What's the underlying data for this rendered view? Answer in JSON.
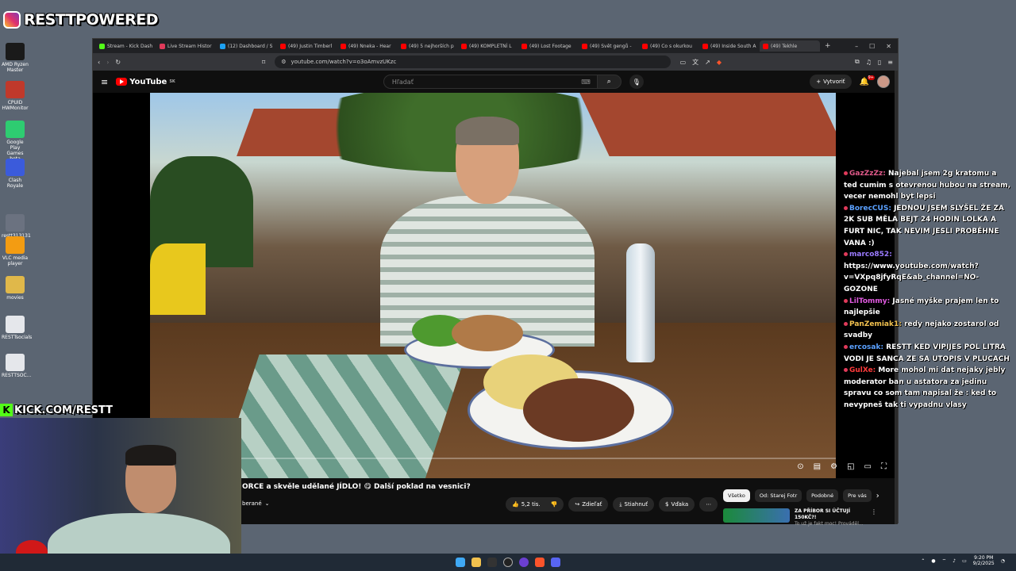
{
  "overlay": {
    "brand": "RESTTPOWERED",
    "kick": "KICK.COM/RESTT"
  },
  "desktop": {
    "icons": [
      {
        "label": "AMD Ryzen Master",
        "color": "#1a1a1a"
      },
      {
        "label": "CPUID HWMonitor",
        "color": "#c0392b"
      },
      {
        "label": "Google Play Games beta",
        "color": "#2ecc71"
      },
      {
        "label": "Clash Royale",
        "color": "#3b5bdb"
      },
      {
        "label": "restt313131",
        "color": "#6b7280"
      },
      {
        "label": "VLC media player",
        "color": "#f39c12"
      },
      {
        "label": "movies",
        "color": "#e0b84a"
      },
      {
        "label": "RESTTsocials",
        "color": "#e5e7eb"
      },
      {
        "label": "RESTTSOC...",
        "color": "#e5e7eb"
      }
    ]
  },
  "browser": {
    "tabs": [
      {
        "label": "Stream - Kick Dash",
        "color": "#53fc18"
      },
      {
        "label": "Live Stream Histor",
        "color": "#e03a5a"
      },
      {
        "label": "(12) Dashboard / S",
        "color": "#1da1f2"
      },
      {
        "label": "(49) Justin Timberl",
        "color": "#ff0000"
      },
      {
        "label": "(49) Nneka - Hear",
        "color": "#ff0000"
      },
      {
        "label": "(49) 5 nejhorších p",
        "color": "#ff0000"
      },
      {
        "label": "(49) KOMPLETNÍ L",
        "color": "#ff0000"
      },
      {
        "label": "(49) Lost Footage",
        "color": "#ff0000"
      },
      {
        "label": "(49) Svět gengů - ",
        "color": "#ff0000"
      },
      {
        "label": "(49) Co s okurkou",
        "color": "#ff0000"
      },
      {
        "label": "(49) Inside South A",
        "color": "#ff0000"
      },
      {
        "label": "(49) Tekhle",
        "color": "#ff0000"
      }
    ],
    "url": "youtube.com/watch?v=o3oAmvzUKzc"
  },
  "youtube": {
    "logo": "YouTube",
    "region": "SK",
    "search_placeholder": "Hľadať",
    "create_label": "Vytvoriť",
    "notifications": "9+",
    "video_title": "ORCE a skvěle udělané JÍDLO! 😋 Další poklad na vesnici?",
    "channel": "berané",
    "likes": "5,2 tis.",
    "share": "Zdieľať",
    "download": "Stiahnuť",
    "thanks": "Vďaka",
    "progress": 0.083,
    "chips": [
      "Všetko",
      "Od: Starej Fotr",
      "Podobné",
      "Pre vás"
    ],
    "rec_title": "ZA PŘÍBOR SI ÚČTUJÍ 150KČ?!",
    "rec_sub": "To už je fakt moc! Prováděl..."
  },
  "chat": [
    {
      "user": "GazZzZz",
      "color": "#e05a8a",
      "text": "Najebal jsem 2g kratomu a ted cumim s otevrenou hubou na stream, vecer nemohl byt lepsi"
    },
    {
      "user": "BorecCUS",
      "color": "#5aa0ff",
      "text": "JEDNOU JSEM SLYŠEL ŽE ZA 2K SUB MĚLA BEJT 24 HODIN LOLKA A FURT NIC, TAK NEVIM JESLI PROBĚHNE VANA :)"
    },
    {
      "user": "marco852",
      "color": "#9b7bff",
      "text": "https://www.youtube.com/watch?v=VXpq8jfyRqE&ab_channel=NO-GOZONE"
    },
    {
      "user": "LilTommy",
      "color": "#e05ae0",
      "text": "Jasné myške prajem len to najlepšie"
    },
    {
      "user": "PanZemiak1",
      "color": "#f2c14e",
      "text": "redy nejako zostarol od svadby"
    },
    {
      "user": "ercosak",
      "color": "#5aa0ff",
      "text": "RESTT KED VIPIJES POL LITRA VODI JE SANCA ZE SA UTOPIS V PLUCACH"
    },
    {
      "user": "GulXe",
      "color": "#ff3b3b",
      "text": "More mohol mi dat nejaky jebly moderator ban u astatora za jedinu spravu co som tam napisal že : ked to nevypneš tak ti vypadnu vlasy"
    }
  ],
  "taskbar": {
    "time": "9:20 PM",
    "date": "9/2/2025"
  }
}
